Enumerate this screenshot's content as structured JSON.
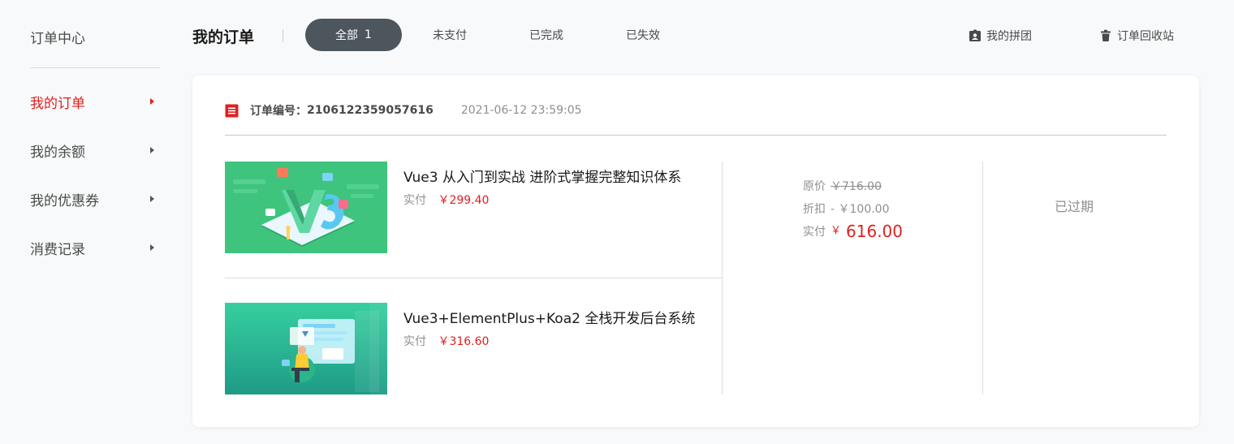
{
  "sidebar": {
    "title": "订单中心",
    "items": [
      {
        "label": "我的订单",
        "active": true
      },
      {
        "label": "我的余额",
        "active": false
      },
      {
        "label": "我的优惠券",
        "active": false
      },
      {
        "label": "消费记录",
        "active": false
      }
    ]
  },
  "header": {
    "title": "我的订单",
    "tabs": [
      {
        "label": "全部",
        "count": "1",
        "active": true
      },
      {
        "label": "未支付",
        "active": false
      },
      {
        "label": "已完成",
        "active": false
      },
      {
        "label": "已失效",
        "active": false
      }
    ],
    "links": {
      "group_buy": "我的拼团",
      "recycle_bin": "订单回收站"
    }
  },
  "order": {
    "number_label": "订单编号：",
    "number": "2106122359057616",
    "time": "2021-06-12 23:59:05",
    "products": [
      {
        "name": "Vue3 从入门到实战 进阶式掌握完整知识体系",
        "paid_label": "实付",
        "paid": "￥299.40"
      },
      {
        "name": "Vue3+ElementPlus+Koa2 全栈开发后台系统",
        "paid_label": "实付",
        "paid": "￥316.60"
      }
    ],
    "summary": {
      "original_label": "原价",
      "original": "￥716.00",
      "discount_label": "折扣",
      "discount": "- ￥100.00",
      "paid_label": "实付",
      "currency": "￥",
      "paid": "616.00"
    },
    "status": "已过期"
  },
  "colors": {
    "accent": "#e02020",
    "tab_active_bg": "#4d555d",
    "page_bg": "#f8f9fa",
    "thumb_green": "#3ec47d",
    "thumb_teal": "#2fbf9b"
  },
  "icons": {
    "order": "receipt-icon",
    "group_buy": "badge-icon",
    "recycle_bin": "trash-icon",
    "arrow": "caret-right-icon"
  }
}
